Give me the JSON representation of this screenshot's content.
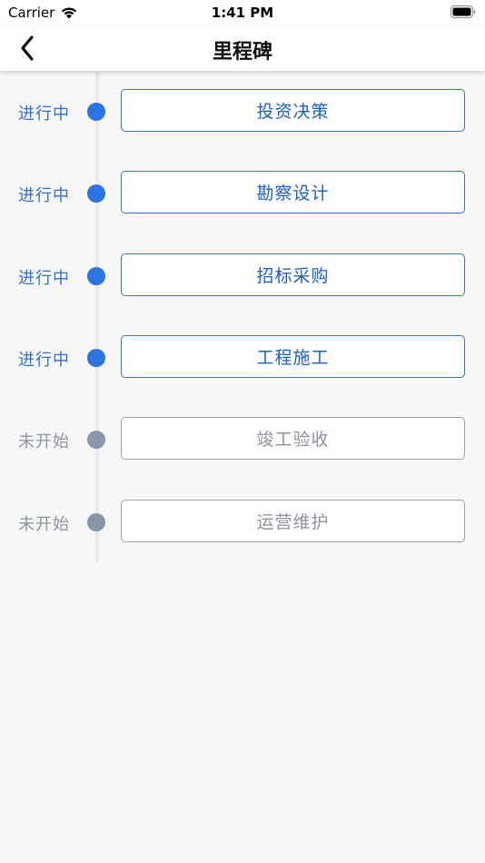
{
  "status_bar": {
    "carrier": "Carrier",
    "time": "1:41 PM"
  },
  "nav": {
    "title": "里程碑",
    "back_icon": "chevron-left-icon"
  },
  "colors": {
    "active": "#2b74e2",
    "pending": "#8b95aa"
  },
  "milestones": [
    {
      "status": "进行中",
      "state": "active",
      "label": "投资决策"
    },
    {
      "status": "进行中",
      "state": "active",
      "label": "勘察设计"
    },
    {
      "status": "进行中",
      "state": "active",
      "label": "招标采购"
    },
    {
      "status": "进行中",
      "state": "active",
      "label": "工程施工"
    },
    {
      "status": "未开始",
      "state": "pending",
      "label": "竣工验收"
    },
    {
      "status": "未开始",
      "state": "pending",
      "label": "运营维护"
    }
  ]
}
